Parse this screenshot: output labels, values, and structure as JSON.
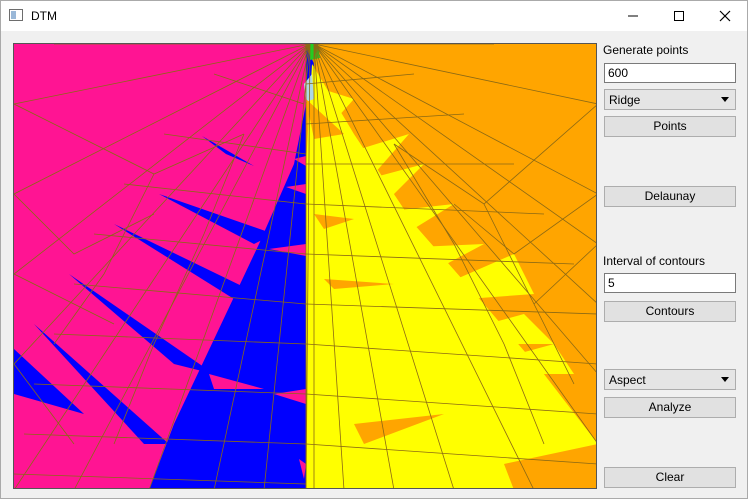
{
  "window": {
    "title": "DTM",
    "icon": "app-window-icon"
  },
  "controls": {
    "minimize": "minimize-icon",
    "maximize": "maximize-icon",
    "close": "close-icon"
  },
  "panel": {
    "generate_label": "Generate points",
    "points_count": "600",
    "shape_select": "Ridge",
    "points_button": "Points",
    "delaunay_button": "Delaunay",
    "interval_label": "Interval of contours",
    "interval_value": "5",
    "contours_button": "Contours",
    "analysis_select": "Aspect",
    "analyze_button": "Analyze",
    "clear_button": "Clear"
  },
  "colors": {
    "pink": "#ff1493",
    "blue": "#0000ff",
    "yellow": "#ffff00",
    "orange": "#ffa500",
    "green": "#22cc22",
    "edge": "#8b6914"
  }
}
